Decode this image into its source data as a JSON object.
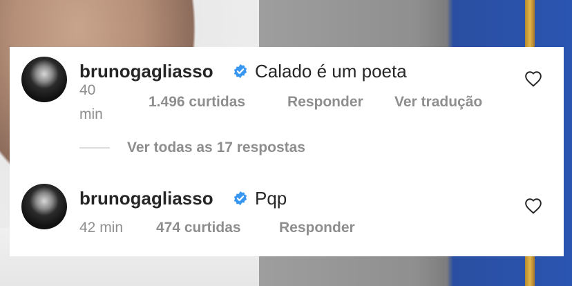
{
  "comments": [
    {
      "username": "brunogagliasso",
      "text": "Calado é um poeta",
      "time": "40\nmin",
      "time_line1": "40",
      "time_line2": "min",
      "likes": "1.496 curtidas",
      "reply": "Responder",
      "translate": "Ver tradução"
    },
    {
      "username": "brunogagliasso",
      "text": "Pqp",
      "time": "42 min",
      "likes": "474 curtidas",
      "reply": "Responder"
    }
  ],
  "replies_link": "Ver todas as 17 respostas",
  "icons": {
    "verified": "verified-badge-icon",
    "like": "heart-icon"
  },
  "colors": {
    "verified_blue": "#3897f0",
    "text_primary": "#262626",
    "text_secondary": "#8e8e8e"
  }
}
